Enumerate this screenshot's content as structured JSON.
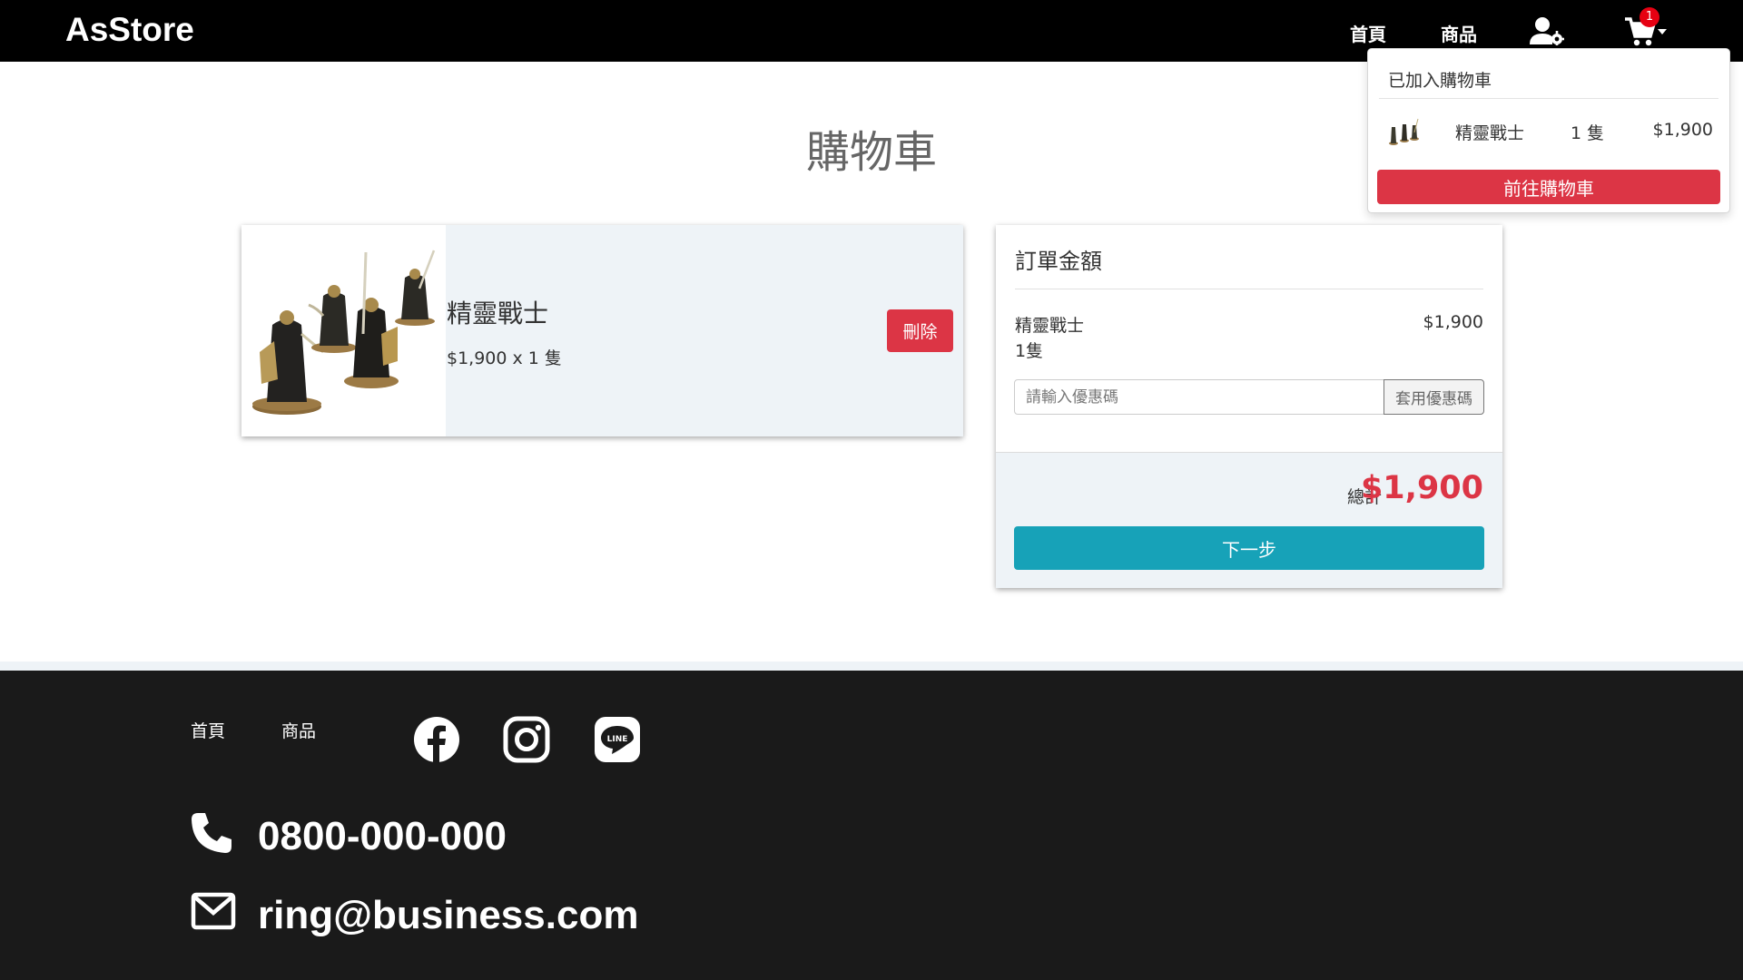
{
  "navbar": {
    "brand": "AsStore",
    "links": [
      "首頁",
      "商品"
    ],
    "cart_count": "1"
  },
  "dropdown": {
    "header": "已加入購物車",
    "item": {
      "name": "精靈戰士",
      "qty": "1 隻",
      "price": "$1,900"
    },
    "button": "前往購物車"
  },
  "page": {
    "title": "購物車"
  },
  "cart_item": {
    "name": "精靈戰士",
    "price_qty": "$1,900 x 1 隻",
    "delete_label": "刪除"
  },
  "summary": {
    "title": "訂單金額",
    "item_name": "精靈戰士",
    "item_qty": "1隻",
    "item_price": "$1,900",
    "coupon_placeholder": "請輸入優惠碼",
    "coupon_button": "套用優惠碼",
    "total_label": "總計",
    "total_value": "$1,900",
    "next_button": "下一步"
  },
  "footer": {
    "links": [
      "首頁",
      "商品"
    ],
    "social": [
      "facebook-icon",
      "instagram-icon",
      "line-icon"
    ],
    "phone": "0800-000-000",
    "email": "ring@business.com"
  },
  "colors": {
    "accent_red": "#dc3545",
    "accent_teal": "#17a2b8",
    "navbar_bg": "#000000",
    "footer_bg": "#1a1a1a"
  }
}
